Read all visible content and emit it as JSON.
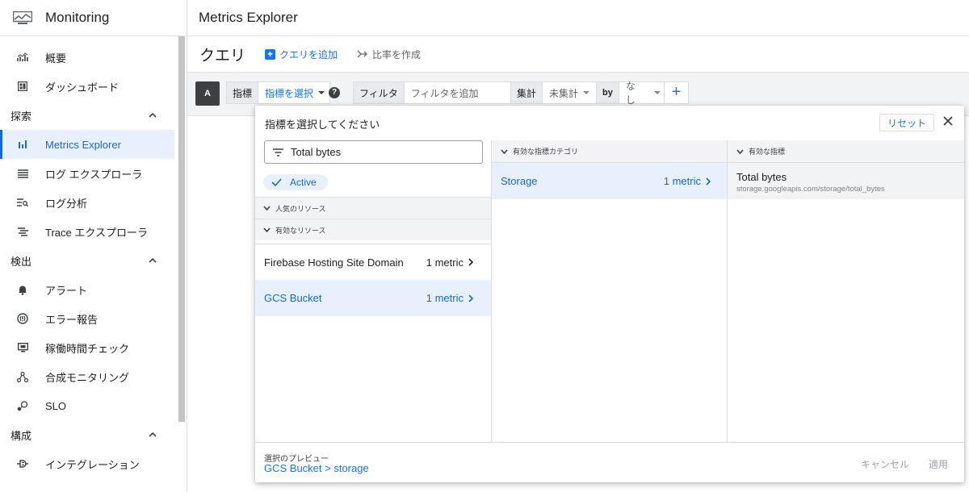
{
  "sidebar": {
    "app_title": "Monitoring",
    "items_top": [
      {
        "label": "概要",
        "icon": "chart-icon"
      },
      {
        "label": "ダッシュボード",
        "icon": "dashboard-icon"
      }
    ],
    "section_explore": "探索",
    "items_explore": [
      {
        "label": "Metrics Explorer",
        "icon": "bar-chart-icon",
        "active": true
      },
      {
        "label": "ログ エクスプローラ",
        "icon": "list-icon"
      },
      {
        "label": "ログ分析",
        "icon": "log-analytics-icon"
      },
      {
        "label": "Trace エクスプローラ",
        "icon": "trace-icon"
      }
    ],
    "section_detect": "検出",
    "items_detect": [
      {
        "label": "アラート",
        "icon": "bell-icon"
      },
      {
        "label": "エラー報告",
        "icon": "error-report-icon"
      },
      {
        "label": "稼働時間チェック",
        "icon": "monitor-icon"
      },
      {
        "label": "合成モニタリング",
        "icon": "synthetic-icon"
      },
      {
        "label": "SLO",
        "icon": "slo-icon"
      }
    ],
    "section_config": "構成",
    "items_config": [
      {
        "label": "インテグレーション",
        "icon": "integration-icon"
      }
    ]
  },
  "topbar": {
    "title": "Metrics Explorer"
  },
  "querybar": {
    "title": "クエリ",
    "add_query": "クエリを追加",
    "ratio": "比率を作成"
  },
  "editor": {
    "query_letter": "A",
    "metric_label": "指標",
    "metric_value": "指標を選択",
    "filter_label": "フィルタ",
    "filter_placeholder": "フィルタを追加",
    "agg_label": "集計",
    "agg_value": "未集計",
    "by_label": "by",
    "by_value": "なし"
  },
  "modal": {
    "title": "指標を選択してください",
    "reset": "リセット",
    "search_value": "Total bytes",
    "active_chip": "Active",
    "group_popular": "人気のリソース",
    "group_active": "有効なリソース",
    "resources": [
      {
        "name": "Firebase Hosting Site Domain",
        "count": "1 metric"
      },
      {
        "name": "GCS Bucket",
        "count": "1 metric",
        "selected": true
      }
    ],
    "col2_header": "有効な指標カテゴリ",
    "category": {
      "name": "Storage",
      "count": "1 metric"
    },
    "col3_header": "有効な指標",
    "metric": {
      "name": "Total bytes",
      "path": "storage.googleapis.com/storage/total_bytes"
    },
    "preview_label": "選択のプレビュー",
    "preview_value": "GCS Bucket > storage",
    "cancel": "キャンセル",
    "apply": "適用"
  },
  "colors": {
    "accent": "#1a73e8",
    "selected_bg": "#e8f0fe",
    "header_bg": "#f1f3f4"
  }
}
